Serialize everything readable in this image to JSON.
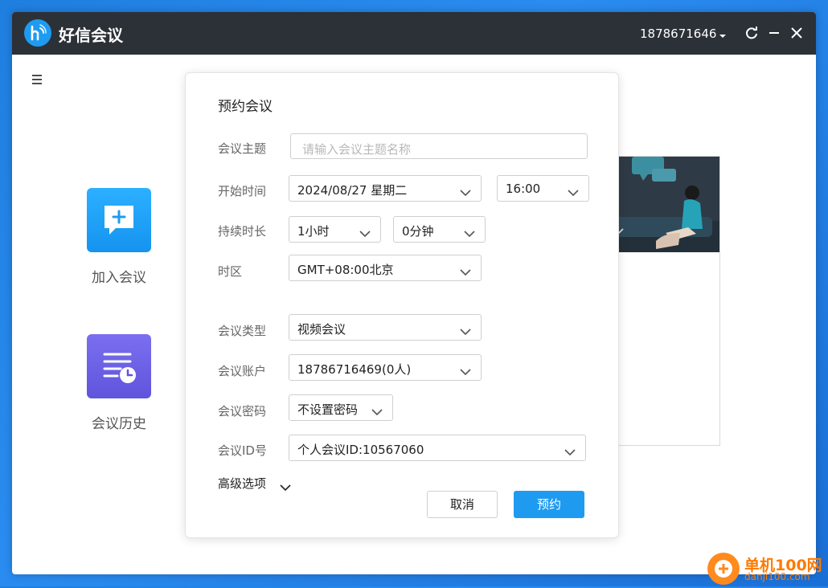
{
  "app": {
    "title": "好信会议",
    "user_phone": "1878671646"
  },
  "sidebar": {
    "join_label": "加入会议",
    "history_label": "会议历史"
  },
  "dialog": {
    "title": "预约会议",
    "subject": {
      "label": "会议主题",
      "placeholder": "请输入会议主题名称",
      "value": ""
    },
    "start": {
      "label": "开始时间",
      "date": "2024/08/27 星期二",
      "time": "16:00"
    },
    "duration": {
      "label": "持续时长",
      "hours": "1小时",
      "minutes": "0分钟"
    },
    "timezone": {
      "label": "时区",
      "value": "GMT+08:00北京"
    },
    "type": {
      "label": "会议类型",
      "value": "视频会议"
    },
    "account": {
      "label": "会议账户",
      "value": "18786716469(0人)"
    },
    "password": {
      "label": "会议密码",
      "value": "不设置密码"
    },
    "meeting_id": {
      "label": "会议ID号",
      "value": "个人会议ID:10567060"
    },
    "advanced_label": "高级选项",
    "cancel_label": "取消",
    "submit_label": "预约"
  },
  "watermark": {
    "text": "单机100网",
    "sub": "danji100.com"
  },
  "colors": {
    "accent": "#1e9bf0",
    "titlebar": "#2c3137",
    "history_tile": "#6f64e6"
  },
  "icons": [
    "logo-icon",
    "caret-down-icon",
    "refresh-icon",
    "minimize-icon",
    "close-icon",
    "menu-icon",
    "chat-plus-icon",
    "history-clock-icon",
    "chevron-down-icon"
  ]
}
